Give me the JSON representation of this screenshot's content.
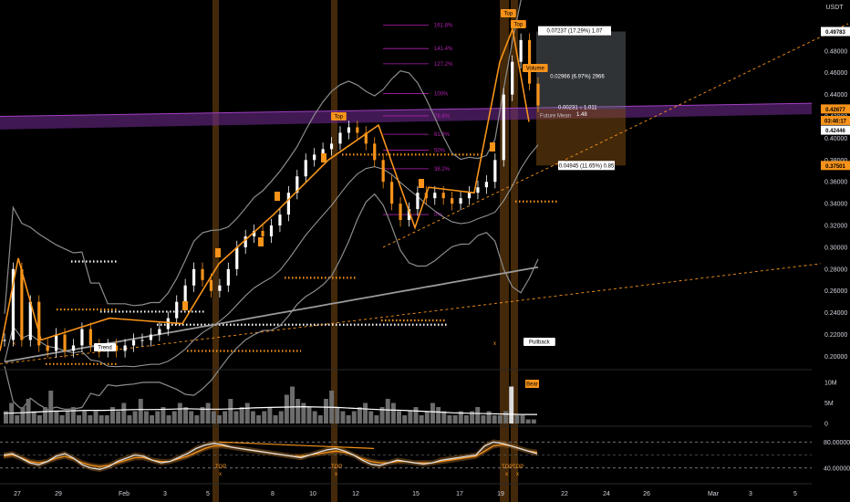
{
  "header": {
    "currency": "USDT"
  },
  "colors": {
    "background": "#000000",
    "accent": "#f7931a",
    "candle_up": "#ffffff",
    "candle_down": "#f7931a",
    "band": "#8c8c8c",
    "fib": "#b020b0",
    "purple_zone": "#6a2a8a",
    "highlight_col": "#7a4a12",
    "rsi_line": "#e0e0e0",
    "rsi_signal": "#f7931a"
  },
  "chart_data": [
    {
      "type": "candlestick",
      "x_labels": [
        "27",
        "29",
        "Feb",
        "3",
        "5",
        "8",
        "10",
        "12",
        "15",
        "17",
        "19",
        "22",
        "24",
        "26",
        "Mar",
        "3",
        "5"
      ],
      "y_ticks": [
        "0.48000",
        "0.46000",
        "0.44000",
        "0.42000",
        "0.40000",
        "0.38000",
        "0.36000",
        "0.34000",
        "0.32000",
        "0.30000",
        "0.28000",
        "0.26000",
        "0.24000",
        "0.22000",
        "0.20000"
      ],
      "ylim": [
        0.192,
        0.52
      ],
      "price_labels": [
        {
          "text": "0.49783",
          "value": 0.4978,
          "style": "white"
        },
        {
          "text": "0.42677",
          "value": 0.4268,
          "style": "orange"
        },
        {
          "text": "03:46:17",
          "value": 0.4163,
          "style": "orange"
        },
        {
          "text": "0.42446",
          "value": 0.4074,
          "style": "white"
        },
        {
          "text": "0.37501",
          "value": 0.375,
          "style": "orange"
        }
      ],
      "close_series": [
        0.215,
        0.28,
        0.215,
        0.25,
        0.21,
        0.205,
        0.22,
        0.205,
        0.21,
        0.225,
        0.21,
        0.205,
        0.21,
        0.205,
        0.21,
        0.215,
        0.215,
        0.22,
        0.225,
        0.235,
        0.25,
        0.265,
        0.28,
        0.27,
        0.26,
        0.265,
        0.28,
        0.3,
        0.31,
        0.315,
        0.31,
        0.32,
        0.33,
        0.35,
        0.365,
        0.38,
        0.385,
        0.39,
        0.395,
        0.405,
        0.41,
        0.405,
        0.395,
        0.38,
        0.36,
        0.34,
        0.325,
        0.335,
        0.35,
        0.345,
        0.35,
        0.345,
        0.34,
        0.345,
        0.35,
        0.355,
        0.36,
        0.38,
        0.44,
        0.47,
        0.49,
        0.45,
        0.43
      ],
      "fib_levels": [
        {
          "label": "161.8%",
          "value": 0.5037
        },
        {
          "label": "141.4%",
          "value": 0.4822
        },
        {
          "label": "127.2%",
          "value": 0.4682
        },
        {
          "label": "100%",
          "value": 0.441
        },
        {
          "label": "78.6%",
          "value": 0.4205
        },
        {
          "label": "61.8%",
          "value": 0.4036
        },
        {
          "label": "50%",
          "value": 0.389
        },
        {
          "label": "38.2%",
          "value": 0.372
        },
        {
          "label": "0%",
          "value": 0.33
        }
      ],
      "dotted_levels": [
        {
          "value": 0.287,
          "color": "white"
        },
        {
          "value": 0.241,
          "color": "white"
        },
        {
          "value": 0.229,
          "color": "white"
        },
        {
          "value": 0.243,
          "color": "orange"
        },
        {
          "value": 0.272,
          "color": "orange"
        },
        {
          "value": 0.385,
          "color": "orange"
        },
        {
          "value": 0.342,
          "color": "orange"
        },
        {
          "value": 0.233,
          "color": "orange"
        },
        {
          "value": 0.205,
          "color": "orange"
        },
        {
          "value": 0.193,
          "color": "orange"
        }
      ],
      "measure_box": {
        "up_label": "0.07237 (17.29%) 1.07",
        "mid_label": "0.02966 (6.97%) 2966",
        "center_label": "0.00231 ↓ 1.011",
        "center_sub": "1.48",
        "down_label": "0.04945 (11.65%) 0.85",
        "small_label": "Future Mean"
      },
      "markers": [
        {
          "text": "Top",
          "kind": "box",
          "x": 0.394
        },
        {
          "text": "Top",
          "kind": "box",
          "x": 0.598
        },
        {
          "text": "Top",
          "kind": "box",
          "x": 0.608
        },
        {
          "text": "Volume",
          "kind": "box",
          "x": 0.626
        },
        {
          "text": "Trend",
          "kind": "box",
          "x": 0.12
        },
        {
          "text": "Pullback",
          "kind": "box",
          "x": 0.63
        }
      ]
    },
    {
      "type": "bar",
      "name": "volume",
      "y_ticks": [
        "10M",
        "5M",
        "0"
      ],
      "ylim": [
        0,
        12
      ],
      "values": [
        3,
        5,
        2,
        4,
        6,
        3,
        2,
        4,
        8,
        3,
        2,
        3,
        4,
        2,
        3,
        2,
        3,
        2,
        2,
        4,
        3,
        5,
        2,
        3,
        6,
        3,
        2,
        3,
        4,
        2,
        3,
        5,
        4,
        3,
        2,
        4,
        5,
        3,
        2,
        3,
        6,
        3,
        4,
        5,
        3,
        2,
        3,
        4,
        2,
        3,
        7,
        9,
        6,
        5,
        4,
        3,
        2,
        6,
        8,
        4,
        3,
        2,
        3,
        4,
        5,
        3,
        2,
        4,
        6,
        5,
        3,
        2,
        3,
        4,
        2,
        3,
        5,
        4,
        3,
        2,
        2,
        3,
        2,
        3,
        4,
        2,
        3,
        2,
        2,
        3,
        9,
        2,
        2,
        1,
        1
      ],
      "ma_values": [
        2.5,
        2.6,
        2.8,
        3,
        3.1,
        3.2,
        3.2,
        3.3,
        3.4,
        3.4,
        3.5,
        3.6,
        3.5,
        3.5,
        3.6,
        3.8,
        3.9,
        4,
        4.1,
        4,
        3.9,
        3.7,
        3.5,
        3.3,
        3.2,
        3,
        2.8,
        2.6,
        2.5,
        2.4,
        2.3,
        2.2,
        2.2
      ],
      "label": "Bear"
    },
    {
      "type": "line",
      "name": "oscillator",
      "y_ticks": [
        "80.00000",
        "40.00000"
      ],
      "ylim": [
        20,
        100
      ],
      "series": [
        {
          "values": [
            60,
            62,
            55,
            48,
            45,
            50,
            58,
            62,
            55,
            45,
            40,
            38,
            42,
            50,
            55,
            60,
            58,
            52,
            48,
            50,
            56,
            62,
            70,
            75,
            78,
            76,
            72,
            70,
            68,
            66,
            64,
            62,
            60,
            58,
            56,
            60,
            64,
            68,
            70,
            66,
            60,
            52,
            46,
            44,
            48,
            52,
            50,
            48,
            46,
            48,
            52,
            54,
            56,
            58,
            60,
            74,
            80,
            78,
            74,
            70,
            66,
            62
          ]
        },
        {
          "values": [
            58,
            60,
            56,
            50,
            48,
            50,
            55,
            58,
            54,
            48,
            44,
            42,
            44,
            48,
            52,
            56,
            56,
            52,
            50,
            50,
            54,
            58,
            64,
            70,
            74,
            74,
            72,
            70,
            68,
            66,
            64,
            62,
            60,
            58,
            58,
            60,
            62,
            64,
            66,
            64,
            60,
            54,
            50,
            48,
            48,
            50,
            50,
            48,
            48,
            48,
            50,
            52,
            54,
            56,
            58,
            66,
            74,
            76,
            74,
            70,
            66,
            64
          ]
        }
      ],
      "labels": [
        "TOP",
        "TOP",
        "TOP",
        "TOP"
      ],
      "cross_mark": "x"
    }
  ]
}
